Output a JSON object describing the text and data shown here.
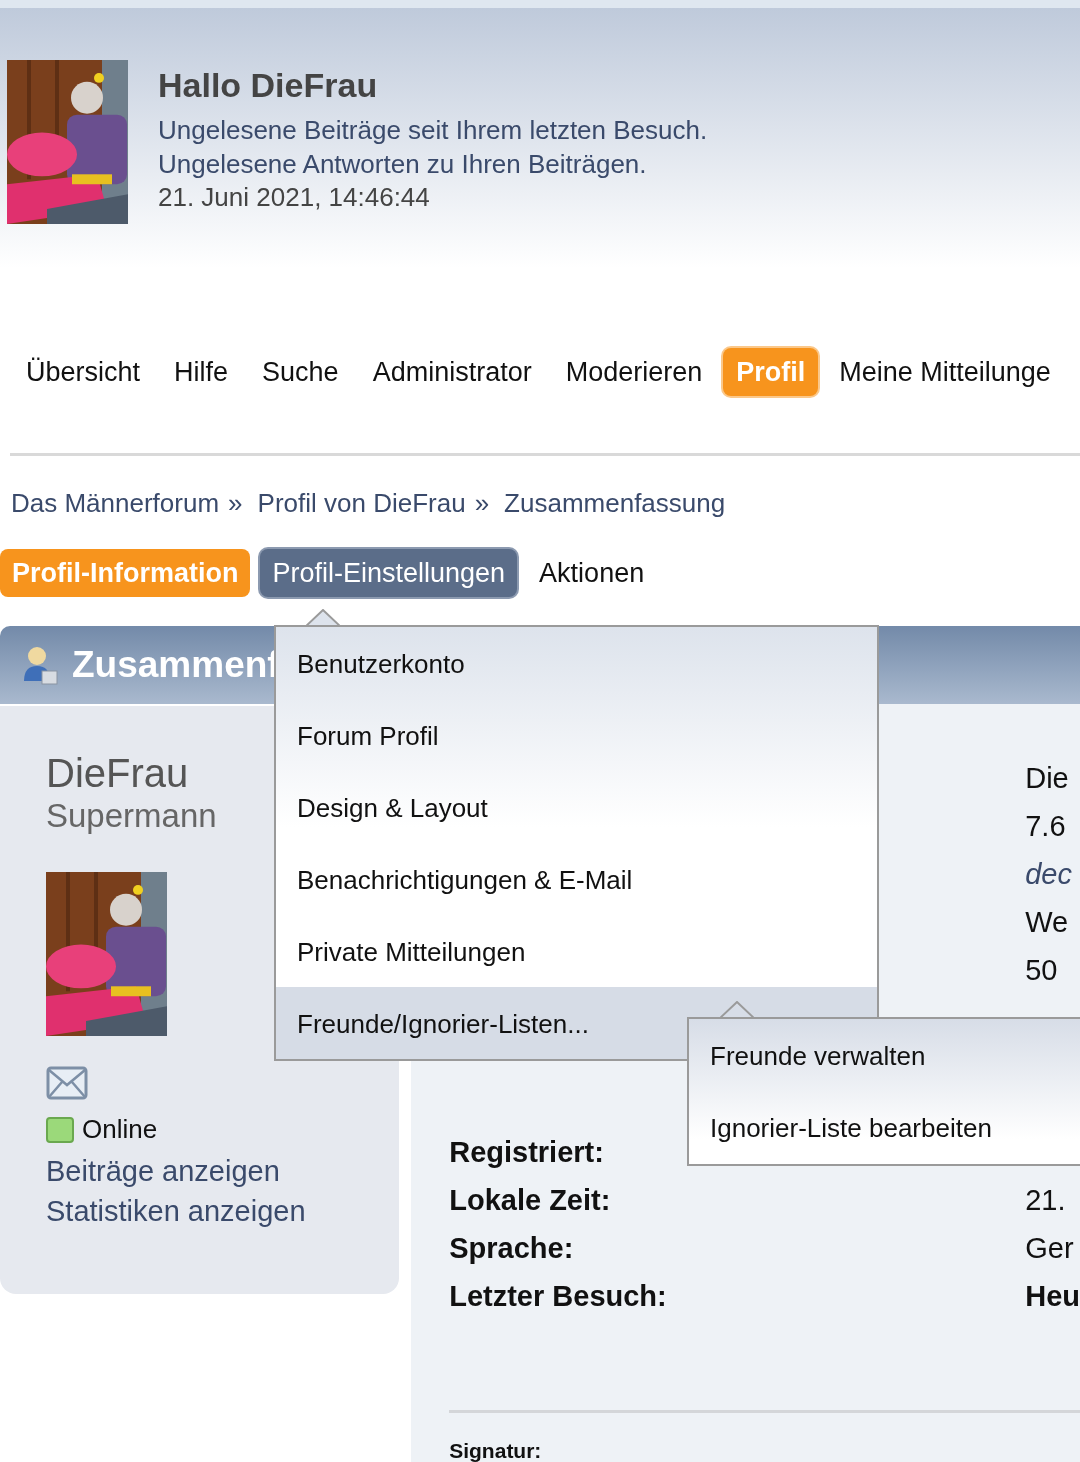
{
  "header": {
    "greeting": "Hallo DieFrau",
    "links": [
      "Ungelesene Beiträge seit Ihrem letzten Besuch.",
      "Ungelesene Antworten zu Ihren Beiträgen."
    ],
    "datetime": "21. Juni 2021, 14:46:44"
  },
  "nav": [
    {
      "label": "Übersicht",
      "selected": false
    },
    {
      "label": "Hilfe",
      "selected": false
    },
    {
      "label": "Suche",
      "selected": false
    },
    {
      "label": "Administrator",
      "selected": false
    },
    {
      "label": "Moderieren",
      "selected": false
    },
    {
      "label": "Profil",
      "selected": true
    },
    {
      "label": "Meine Mitteilunge",
      "selected": false
    }
  ],
  "breadcrumb": [
    {
      "label": "Das Männerforum",
      "separator": "»"
    },
    {
      "label": "Profil von DieFrau",
      "separator": "»"
    },
    {
      "label": "Zusammenfassung"
    }
  ],
  "tabs": [
    {
      "label": "Profil-Information",
      "selected": true,
      "expanded": false
    },
    {
      "label": "Profil-Einstellungen",
      "selected": false,
      "expanded": true
    },
    {
      "label": "Aktionen",
      "selected": false,
      "expanded": false
    }
  ],
  "section_title": "Zusammenf",
  "profile_card": {
    "name": "DieFrau",
    "title": "Supermann",
    "online": true,
    "status": "Online",
    "links": [
      "Beiträge anzeigen",
      "Statistiken anzeigen"
    ]
  },
  "details": {
    "top_values": [
      {
        "text": "Die",
        "kind": "text"
      },
      {
        "text": "7.6",
        "kind": "text"
      },
      {
        "text": "dec",
        "kind": "link"
      },
      {
        "text": "We",
        "kind": "text"
      },
      {
        "text": "50",
        "kind": "text"
      }
    ],
    "rows": [
      {
        "label": "Registriert:"
      },
      {
        "label": "Lokale Zeit:",
        "value": "21.",
        "kind": "text"
      },
      {
        "label": "Sprache:",
        "value": "Ger",
        "kind": "text"
      },
      {
        "label": "Letzter Besuch:",
        "value": "Heu",
        "kind": "strong"
      }
    ],
    "signature_label": "Signatur:"
  },
  "dropdown": {
    "items": [
      {
        "label": "Benutzerkonto",
        "selected": false
      },
      {
        "label": "Forum Profil",
        "selected": false
      },
      {
        "label": "Design & Layout",
        "selected": false
      },
      {
        "label": "Benachrichtigungen & E-Mail",
        "selected": false
      },
      {
        "label": "Private Mitteilungen",
        "selected": false
      },
      {
        "label": "Freunde/Ignorier-Listen...",
        "selected": true
      }
    ],
    "submenu": [
      {
        "label": "Freunde verwalten",
        "selected": false
      },
      {
        "label": "Ignorier-Liste bearbeiten",
        "selected": false
      }
    ]
  }
}
